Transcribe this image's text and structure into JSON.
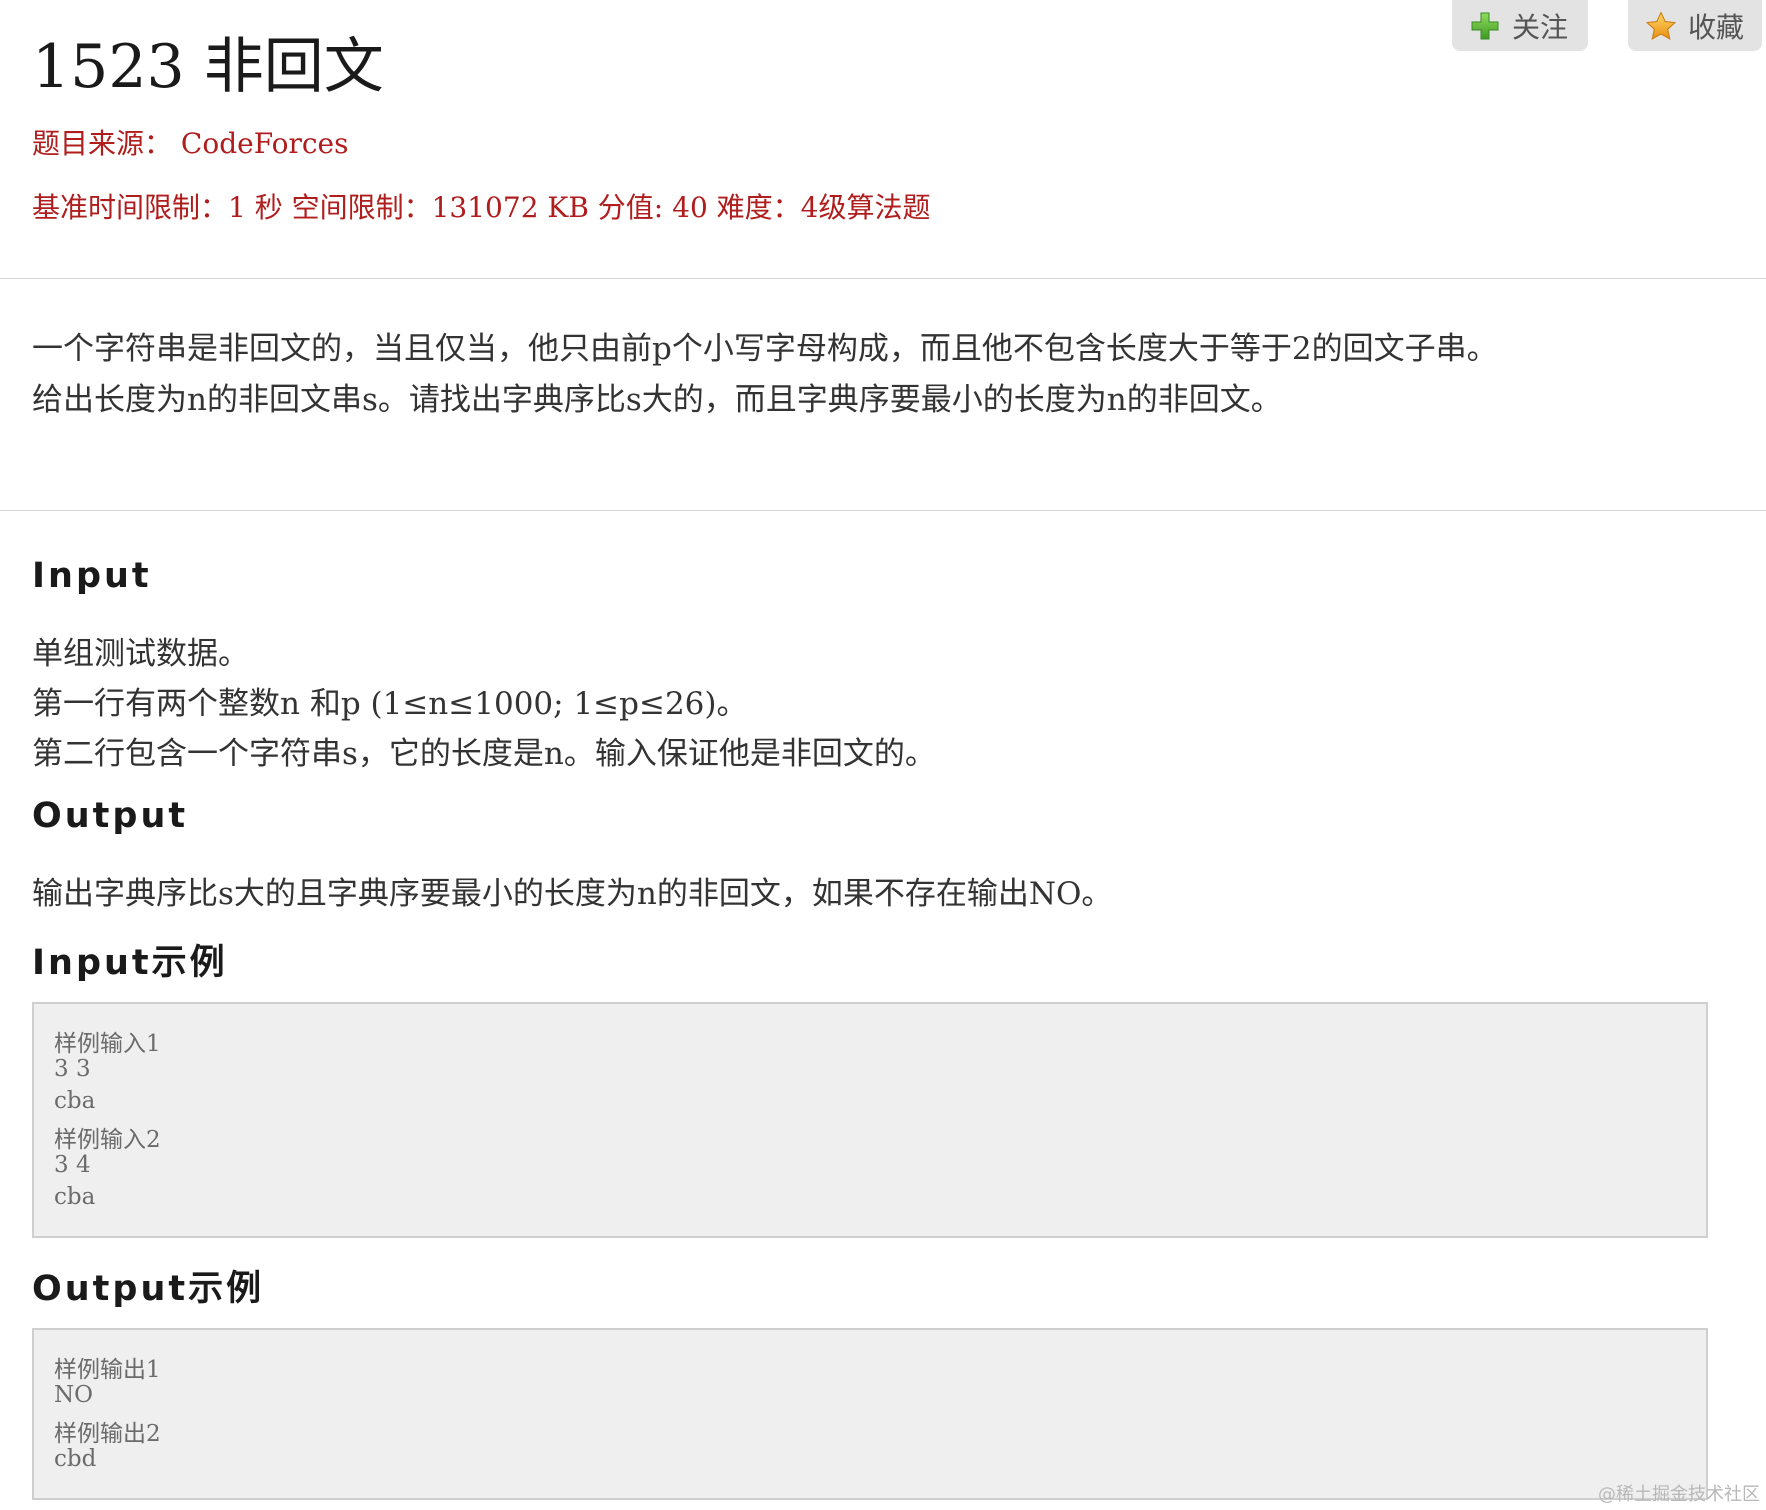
{
  "problem": {
    "title": "1523 非回文",
    "source_label": "题目来源：",
    "source_value": "CodeForces",
    "limits": "基准时间限制：1 秒 空间限制：131072 KB 分值: 40 难度：4级算法题"
  },
  "actions": {
    "follow_label": "关注",
    "favorite_label": "收藏"
  },
  "description": {
    "lines": [
      "一个字符串是非回文的，当且仅当，他只由前p个小写字母构成，而且他不包含长度大于等于2的回文子串。",
      "给出长度为n的非回文串s。请找出字典序比s大的，而且字典序要最小的长度为n的非回文。"
    ]
  },
  "input": {
    "heading": "Input",
    "lines": [
      "单组测试数据。",
      "第一行有两个整数n 和p (1≤n≤1000; 1≤p≤26)。",
      "第二行包含一个字符串s，它的长度是n。输入保证他是非回文的。"
    ]
  },
  "output": {
    "heading": "Output",
    "lines": [
      "输出字典序比s大的且字典序要最小的长度为n的非回文，如果不存在输出NO。"
    ]
  },
  "input_example": {
    "heading": "Input示例",
    "lines": [
      "样例输入1",
      "3 3",
      "cba",
      "样例输入2",
      "3 4",
      "cba"
    ]
  },
  "output_example": {
    "heading": "Output示例",
    "lines": [
      "样例输出1",
      "NO",
      "样例输出2",
      "cbd"
    ]
  },
  "watermark": "@稀土掘金技术社区",
  "colors": {
    "meta_red": "#b01d1d",
    "button_bg": "#e3e3e3",
    "sample_bg": "#efefef",
    "plus_icon_green": "#5cb83a",
    "star_icon_gold": "#f2a51a"
  },
  "icons": {
    "follow": "plus-icon",
    "favorite": "star-icon"
  }
}
